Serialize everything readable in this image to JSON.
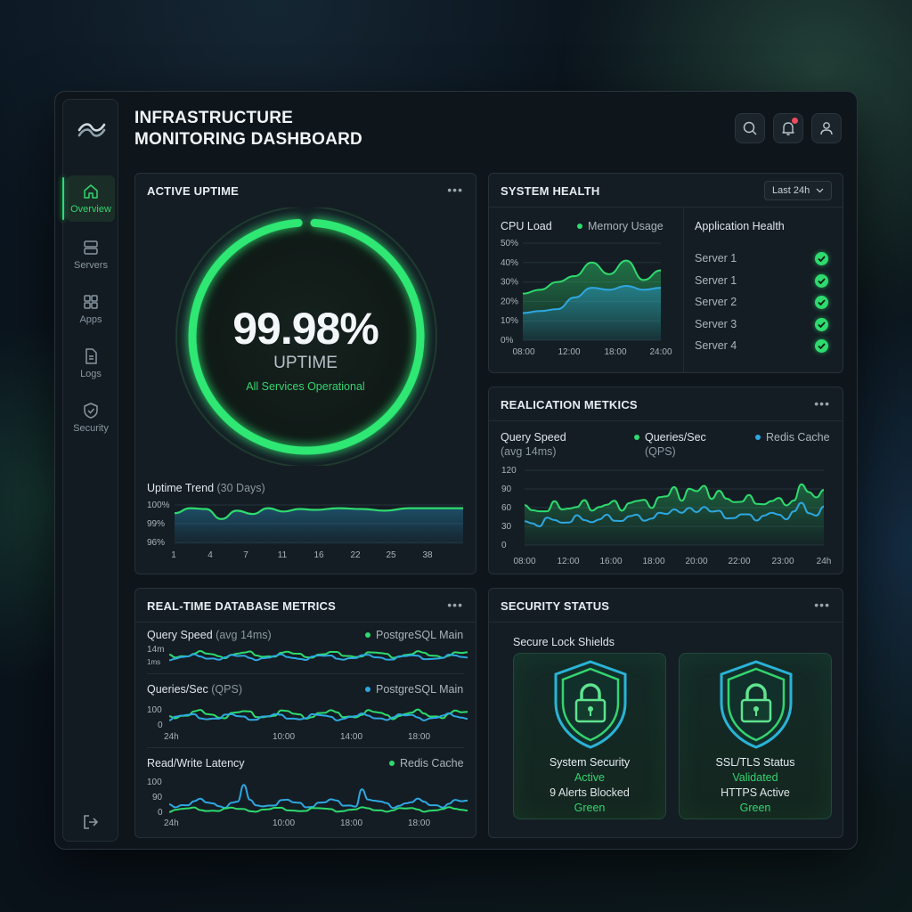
{
  "title_line1": "INFRASTRUCTURE",
  "title_line2": "MONITORING DASHBOARD",
  "sidebar": {
    "items": [
      {
        "label": "Overview",
        "icon": "home-icon"
      },
      {
        "label": "Servers",
        "icon": "server-icon"
      },
      {
        "label": "Apps",
        "icon": "grid-icon"
      },
      {
        "label": "Logs",
        "icon": "document-icon"
      },
      {
        "label": "Security",
        "icon": "shield-icon"
      }
    ],
    "active": "Overview"
  },
  "colors": {
    "accent": "#2edb6e",
    "blue": "#2ea7e0",
    "alert": "#ef4a5b"
  },
  "uptime": {
    "title": "ACTIVE UPTIME",
    "value": "99.98%",
    "value_fraction": 0.9998,
    "label": "UPTIME",
    "status": "All Services Operational",
    "trend_label": "Uptime Trend",
    "trend_range": "(30 Days)",
    "y_ticks": [
      "100%",
      "99%",
      "96%"
    ],
    "x_ticks": [
      "1",
      "4",
      "7",
      "11",
      "16",
      "22",
      "25",
      "38"
    ]
  },
  "system_health": {
    "title": "SYSTEM HEALTH",
    "range": "Last 24h",
    "cpu_label": "CPU Load",
    "memory_label": "Memory Usage",
    "y_ticks": [
      "50%",
      "40%",
      "30%",
      "20%",
      "10%",
      "0%"
    ],
    "x_ticks": [
      "08:00",
      "12:00",
      "18:00",
      "24:00"
    ],
    "app_health_title": "Application Health",
    "servers": [
      "Server 1",
      "Server 1",
      "Server 2",
      "Server 3",
      "Server 4"
    ]
  },
  "app_metrics": {
    "title": "REALICATION METKICS",
    "query_speed": "Query Speed",
    "query_speed_sub": "(avg 14ms)",
    "qps_label": "Queries/Sec",
    "qps_sub": "(QPS)",
    "redis_label": "Redis Cache",
    "y_ticks": [
      "120",
      "90",
      "60",
      "30",
      "0"
    ],
    "x_ticks": [
      "08:00",
      "12:00",
      "16:00",
      "18:00",
      "20:00",
      "22:00",
      "23:00",
      "24h"
    ]
  },
  "db_metrics": {
    "title": "REAL-TIME DATABASE METRICS",
    "row1_label": "Query Speed",
    "row1_sub": "(avg 14ms)",
    "row1_legend": "PostgreSQL Main",
    "row1_ticks": [
      "14m",
      "1ms"
    ],
    "row2_label": "Queries/Sec",
    "row2_sub": "(QPS)",
    "row2_legend": "PostgreSQL Main",
    "row2_ticks": [
      "100",
      "0"
    ],
    "row2_x": [
      "24h",
      "10:00",
      "14:00",
      "18:00"
    ],
    "row3_label": "Read/Write Latency",
    "row3_legend": "Redis Cache",
    "row3_ticks": [
      "100",
      "90",
      "0"
    ],
    "row3_x": [
      "24h",
      "10:00",
      "18:00",
      "18:00"
    ]
  },
  "security": {
    "title": "SECURITY STATUS",
    "subtitle": "Secure Lock Shields",
    "card1": {
      "title": "System Security",
      "status": "Active",
      "detail": "9 Alerts Blocked",
      "color": "Green"
    },
    "card2": {
      "title": "SSL/TLS Status",
      "status": "Validated",
      "detail": "HTTPS Active",
      "color": "Green"
    }
  },
  "chart_data": [
    {
      "type": "line",
      "title": "Uptime Trend",
      "x": [
        1,
        3,
        5,
        7,
        9,
        11,
        13,
        15,
        17,
        19,
        22,
        25,
        28,
        31,
        34,
        38
      ],
      "series": [
        {
          "values": [
            99.3,
            99.9,
            99.8,
            98.6,
            99.6,
            99.2,
            99.9,
            99.5,
            99.8,
            99.7,
            99.9,
            99.8,
            99.6,
            99.9,
            99.9,
            99.9
          ]
        }
      ],
      "ylim": [
        96,
        100.5
      ]
    },
    {
      "type": "area",
      "title": "CPU Load / Memory Usage",
      "categories": [
        "08:00",
        "10:00",
        "12:00",
        "14:00",
        "16:00",
        "18:00",
        "20:00",
        "22:00",
        "24:00"
      ],
      "series": [
        {
          "name": "CPU Load",
          "values": [
            24,
            26,
            30,
            33,
            40,
            34,
            41,
            31,
            36
          ]
        },
        {
          "name": "Memory Usage",
          "values": [
            14,
            15,
            16,
            22,
            27,
            26,
            28,
            26,
            27
          ]
        }
      ],
      "ylim": [
        0,
        50
      ]
    },
    {
      "type": "area",
      "title": "Query Speed",
      "categories": [
        "08:00",
        "12:00",
        "16:00",
        "18:00",
        "20:00",
        "22:00",
        "23:00",
        "24h"
      ],
      "series": [
        {
          "name": "Queries/Sec",
          "values": [
            55,
            62,
            63,
            70,
            85,
            72,
            68,
            88
          ]
        },
        {
          "name": "Redis Cache",
          "values": [
            35,
            40,
            42,
            45,
            55,
            45,
            48,
            55
          ]
        }
      ],
      "ylim": [
        0,
        120
      ]
    }
  ]
}
